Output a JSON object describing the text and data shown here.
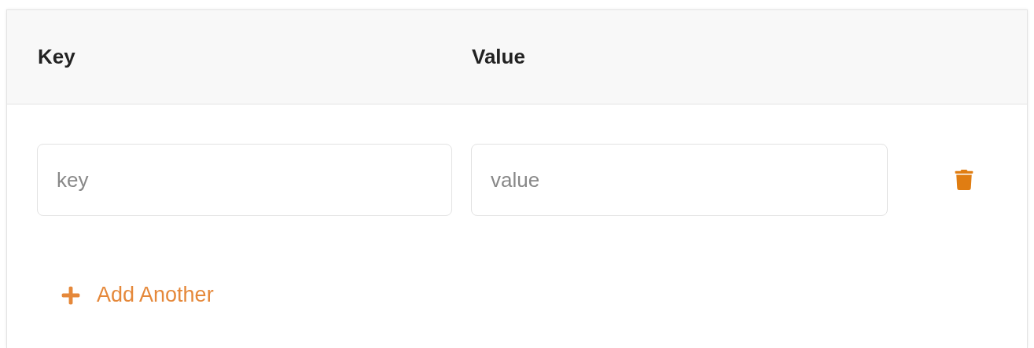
{
  "columns": [
    {
      "label": "Key"
    },
    {
      "label": "Value"
    }
  ],
  "rows": [
    {
      "key_placeholder": "key",
      "value_placeholder": "value"
    }
  ],
  "add_button": {
    "label": "Add Another"
  }
}
